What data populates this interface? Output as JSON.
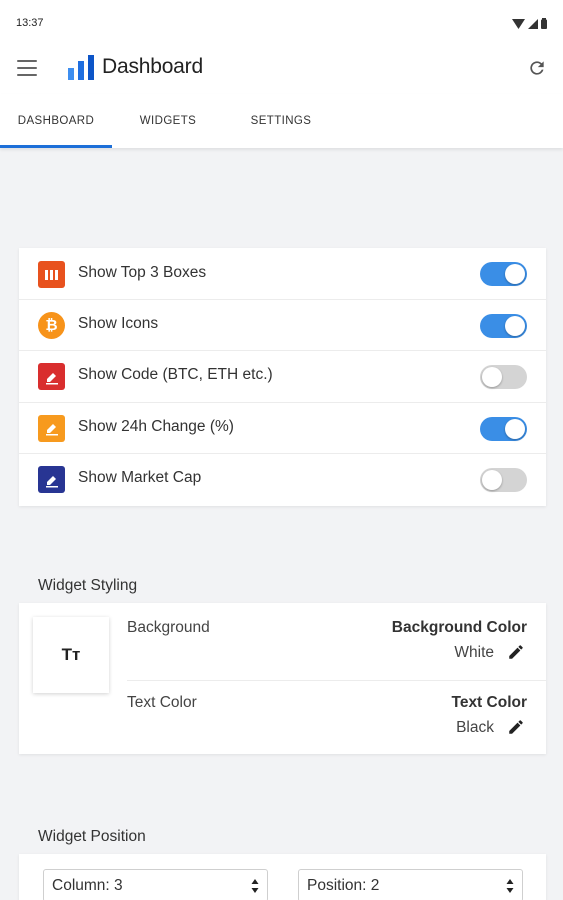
{
  "status_bar": {
    "time": "13:37",
    "icons": [
      "wifi-icon",
      "signal-icon",
      "battery-icon"
    ]
  },
  "app_bar": {
    "title": "Dashboard",
    "menu_icon": "hamburger-menu-icon",
    "logo_icon": "bar-chart-logo-icon",
    "refresh_icon": "refresh-icon"
  },
  "tabs": [
    {
      "label": "DASHBOARD",
      "active": true
    },
    {
      "label": "WIDGETS",
      "active": false
    },
    {
      "label": "SETTINGS",
      "active": false
    }
  ],
  "toggles": [
    {
      "label": "Show Top 3 Boxes",
      "on": true,
      "icon": "boxes-icon",
      "icon_color": "#e8521e"
    },
    {
      "label": "Show Icons",
      "on": true,
      "icon": "bitcoin-icon",
      "icon_color": "#f7931a"
    },
    {
      "label": "Show Code (BTC, ETH etc.)",
      "on": false,
      "icon": "format-code-icon",
      "icon_color": "#d92e2e"
    },
    {
      "label": "Show 24h Change (%)",
      "on": true,
      "icon": "format-change-icon",
      "icon_color": "#f79a1e"
    },
    {
      "label": "Show Market Cap",
      "on": false,
      "icon": "format-marketcap-icon",
      "icon_color": "#283593"
    }
  ],
  "widget_styling": {
    "title": "Widget Styling",
    "preview_text": "Tт",
    "background": {
      "label": "Background",
      "header": "Background Color",
      "value": "White"
    },
    "text_color": {
      "label": "Text Color",
      "header": "Text Color",
      "value": "Black"
    }
  },
  "widget_position": {
    "title": "Widget Position",
    "column": "Column: 3",
    "position": "Position: 2"
  },
  "colors": {
    "accent": "#1d6fd8",
    "switch_on": "#3a8ee6",
    "switch_off": "#d4d4d4",
    "background": "#f2f3f5"
  }
}
